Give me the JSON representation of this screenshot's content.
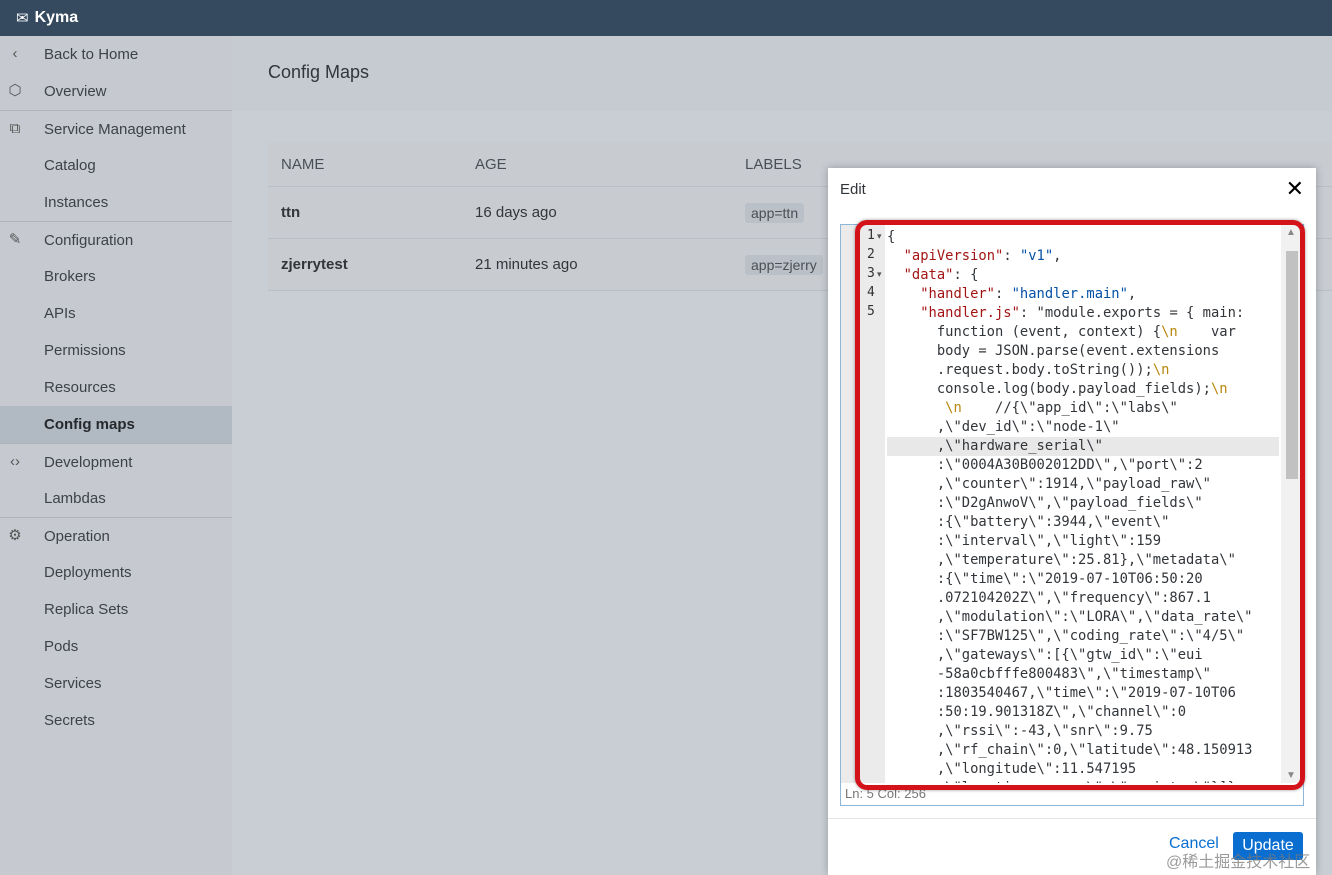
{
  "app": {
    "title": "Kyma",
    "logo_icon": "kyma-logo-icon"
  },
  "sidebar": {
    "items": [
      {
        "label": "Back to Home",
        "icon": "chevron-left-icon",
        "glyph": "‹",
        "section": false,
        "selected": false
      },
      {
        "label": "Overview",
        "icon": "hexagon-icon",
        "glyph": "⬡",
        "section": false,
        "selected": false
      },
      {
        "label": "Service Management",
        "icon": "service-icon",
        "glyph": "⧉",
        "section": true,
        "selected": false
      },
      {
        "label": "Catalog",
        "icon": "",
        "glyph": "",
        "section": false,
        "selected": false
      },
      {
        "label": "Instances",
        "icon": "",
        "glyph": "",
        "section": false,
        "selected": false
      },
      {
        "label": "Configuration",
        "icon": "edit-icon",
        "glyph": "✎",
        "section": true,
        "selected": false
      },
      {
        "label": "Brokers",
        "icon": "",
        "glyph": "",
        "section": false,
        "selected": false
      },
      {
        "label": "APIs",
        "icon": "",
        "glyph": "",
        "section": false,
        "selected": false
      },
      {
        "label": "Permissions",
        "icon": "",
        "glyph": "",
        "section": false,
        "selected": false
      },
      {
        "label": "Resources",
        "icon": "",
        "glyph": "",
        "section": false,
        "selected": false
      },
      {
        "label": "Config maps",
        "icon": "",
        "glyph": "",
        "section": false,
        "selected": true
      },
      {
        "label": "Development",
        "icon": "code-icon",
        "glyph": "‹›",
        "section": true,
        "selected": false
      },
      {
        "label": "Lambdas",
        "icon": "",
        "glyph": "",
        "section": false,
        "selected": false
      },
      {
        "label": "Operation",
        "icon": "operation-icon",
        "glyph": "⚙",
        "section": true,
        "selected": false
      },
      {
        "label": "Deployments",
        "icon": "",
        "glyph": "",
        "section": false,
        "selected": false
      },
      {
        "label": "Replica Sets",
        "icon": "",
        "glyph": "",
        "section": false,
        "selected": false
      },
      {
        "label": "Pods",
        "icon": "",
        "glyph": "",
        "section": false,
        "selected": false
      },
      {
        "label": "Services",
        "icon": "",
        "glyph": "",
        "section": false,
        "selected": false
      },
      {
        "label": "Secrets",
        "icon": "",
        "glyph": "",
        "section": false,
        "selected": false
      }
    ]
  },
  "page": {
    "title": "Config Maps"
  },
  "table": {
    "headers": [
      "NAME",
      "AGE",
      "LABELS"
    ],
    "rows": [
      {
        "name": "ttn",
        "age": "16 days ago",
        "label": "app=ttn"
      },
      {
        "name": "zjerrytest",
        "age": "21 minutes ago",
        "label": "app=zjerry"
      }
    ]
  },
  "modal": {
    "title": "Edit",
    "close_icon": "close-icon",
    "cancel_label": "Cancel",
    "update_label": "Update",
    "status": "Ln: 5   Col: 256",
    "gutter": [
      {
        "n": "1",
        "fold": true
      },
      {
        "n": "2",
        "fold": false
      },
      {
        "n": "3",
        "fold": true
      },
      {
        "n": "4",
        "fold": false
      },
      {
        "n": "5",
        "fold": false
      }
    ],
    "code_lines": [
      "{",
      "  \"apiVersion\": \"v1\",",
      "  \"data\": {",
      "    \"handler\": \"handler.main\",",
      "    \"handler.js\": \"module.exports = { main:",
      "      function (event, context) {\\n    var",
      "      body = JSON.parse(event.extensions",
      "      .request.body.toString());\\n",
      "      console.log(body.payload_fields);\\n",
      "       \\n    //{\\\"app_id\\\":\\\"labs\\\"",
      "      ,\\\"dev_id\\\":\\\"node-1\\\"",
      "      ,\\\"hardware_serial\\\"",
      "      :\\\"0004A30B002012DD\\\",\\\"port\\\":2",
      "      ,\\\"counter\\\":1914,\\\"payload_raw\\\"",
      "      :\\\"D2gAnwoV\\\",\\\"payload_fields\\\"",
      "      :{\\\"battery\\\":3944,\\\"event\\\"",
      "      :\\\"interval\\\",\\\"light\\\":159",
      "      ,\\\"temperature\\\":25.81},\\\"metadata\\\"",
      "      :{\\\"time\\\":\\\"2019-07-10T06:50:20",
      "      .072104202Z\\\",\\\"frequency\\\":867.1",
      "      ,\\\"modulation\\\":\\\"LORA\\\",\\\"data_rate\\\"",
      "      :\\\"SF7BW125\\\",\\\"coding_rate\\\":\\\"4/5\\\"",
      "      ,\\\"gateways\\\":[{\\\"gtw_id\\\":\\\"eui",
      "      -58a0cbfffe800483\\\",\\\"timestamp\\\"",
      "      :1803540467,\\\"time\\\":\\\"2019-07-10T06",
      "      :50:19.901318Z\\\",\\\"channel\\\":0",
      "      ,\\\"rssi\\\":-43,\\\"snr\\\":9.75",
      "      ,\\\"rf_chain\\\":0,\\\"latitude\\\":48.150913",
      "      ,\\\"longitude\\\":11.547195",
      "      ,\\\"location_source\\\":\\\"registry\\\"}]}"
    ],
    "active_line": 11
  },
  "watermark": "@稀土掘金技术社区",
  "colors": {
    "topbar": "#354a5f",
    "accent": "#0a6ed1",
    "highlight": "#d3121a"
  }
}
